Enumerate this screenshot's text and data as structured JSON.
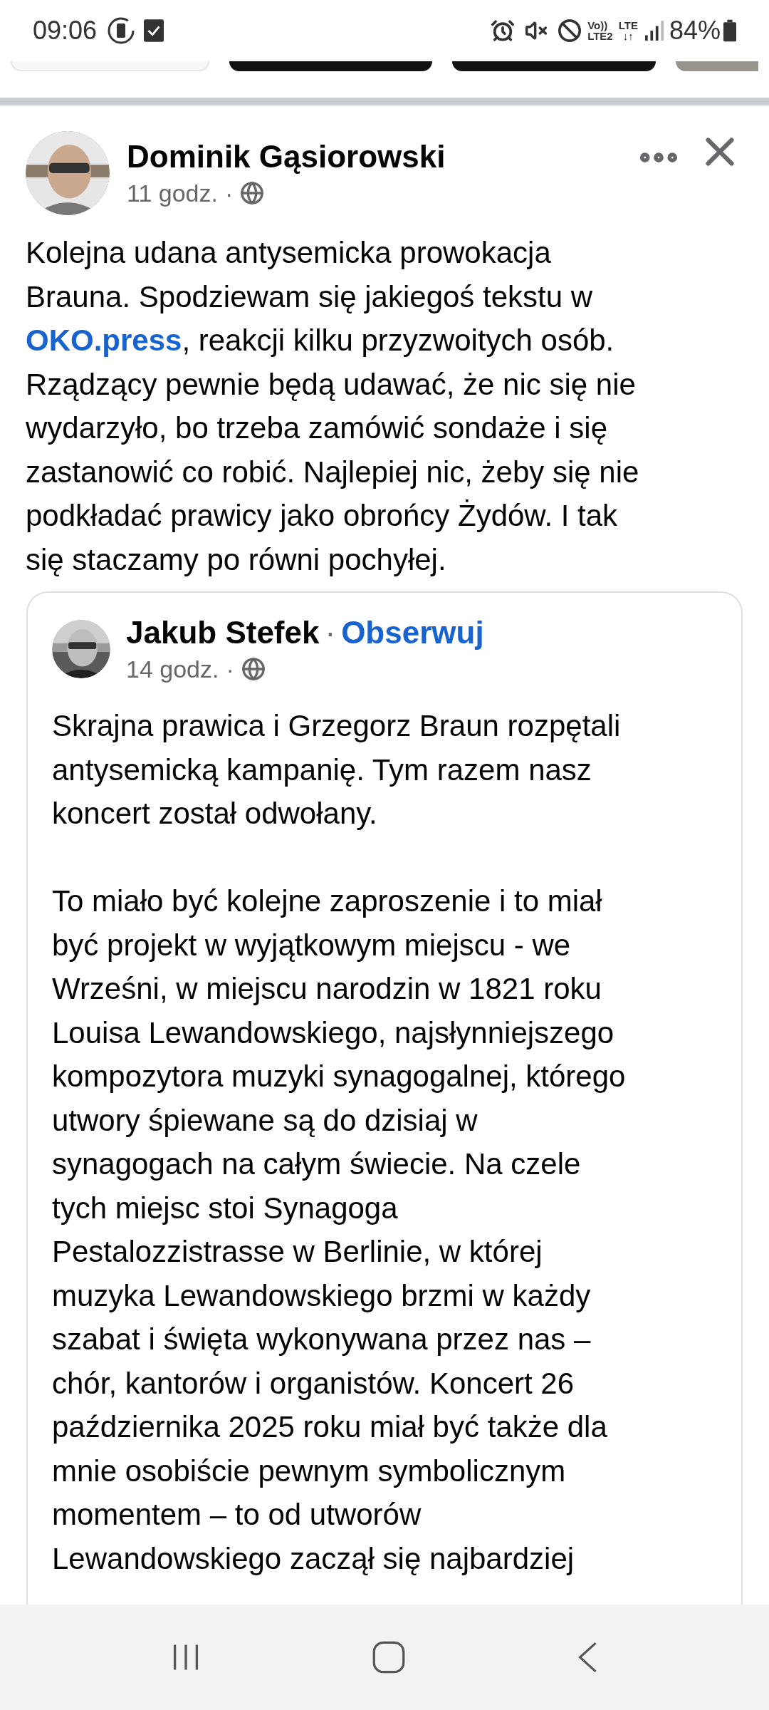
{
  "status_bar": {
    "time": "09:06",
    "volte": [
      "Vo))",
      "LTE2"
    ],
    "lte": [
      "LTE",
      "↓↑"
    ],
    "battery": "84%"
  },
  "post": {
    "author": "Dominik Gąsiorowski",
    "time": "11 godz.",
    "separator": "·",
    "text_lines": [
      {
        "kind": "plain",
        "text": "Kolejna udana antysemicka prowokacja"
      },
      {
        "kind": "plain",
        "text": "Brauna. Spodziewam się jakiegoś tekstu w"
      },
      {
        "kind": "link",
        "link": "OKO.press",
        "text": ", reakcji kilku przyzwoitych osób."
      },
      {
        "kind": "plain",
        "text": "Rządzący pewnie będą udawać, że nic się nie"
      },
      {
        "kind": "plain",
        "text": "wydarzyło, bo trzeba zamówić sondaże i się"
      },
      {
        "kind": "plain",
        "text": "zastanowić co robić. Najlepiej nic, żeby się nie"
      },
      {
        "kind": "plain",
        "text": "podkładać prawicy jako obrońcy Żydów. I tak"
      },
      {
        "kind": "plain",
        "text": "się staczamy po równi pochyłej."
      }
    ]
  },
  "shared_post": {
    "author": "Jakub Stefek",
    "separator": "·",
    "follow": "Obserwuj",
    "time": "14 godz.",
    "time_separator": "·",
    "paragraphs": [
      [
        "Skrajna prawica i Grzegorz Braun rozpętali",
        "antysemicką kampanię. Tym razem nasz",
        "koncert został odwołany."
      ],
      [
        "To miało być kolejne zaproszenie i to miał",
        "być projekt w wyjątkowym miejscu - we",
        "Wrześni, w miejscu narodzin w 1821 roku",
        "Louisa Lewandowskiego, najsłynniejszego",
        "kompozytora muzyki synagogalnej, którego",
        "utwory śpiewane są do dzisiaj w",
        "synagogach na całym świecie. Na czele",
        "tych miejsc stoi Synagoga",
        "Pestalozzistrasse w Berlinie, w której",
        "muzyka Lewandowskiego brzmi w każdy",
        "szabat i święta wykonywana przez nas –",
        "chór, kantorów i organistów. Koncert 26",
        "października 2025 roku miał być także dla",
        "mnie osobiście pewnym symbolicznym",
        "momentem – to od utworów",
        "Lewandowskiego zaczął się najbardziej"
      ]
    ]
  }
}
